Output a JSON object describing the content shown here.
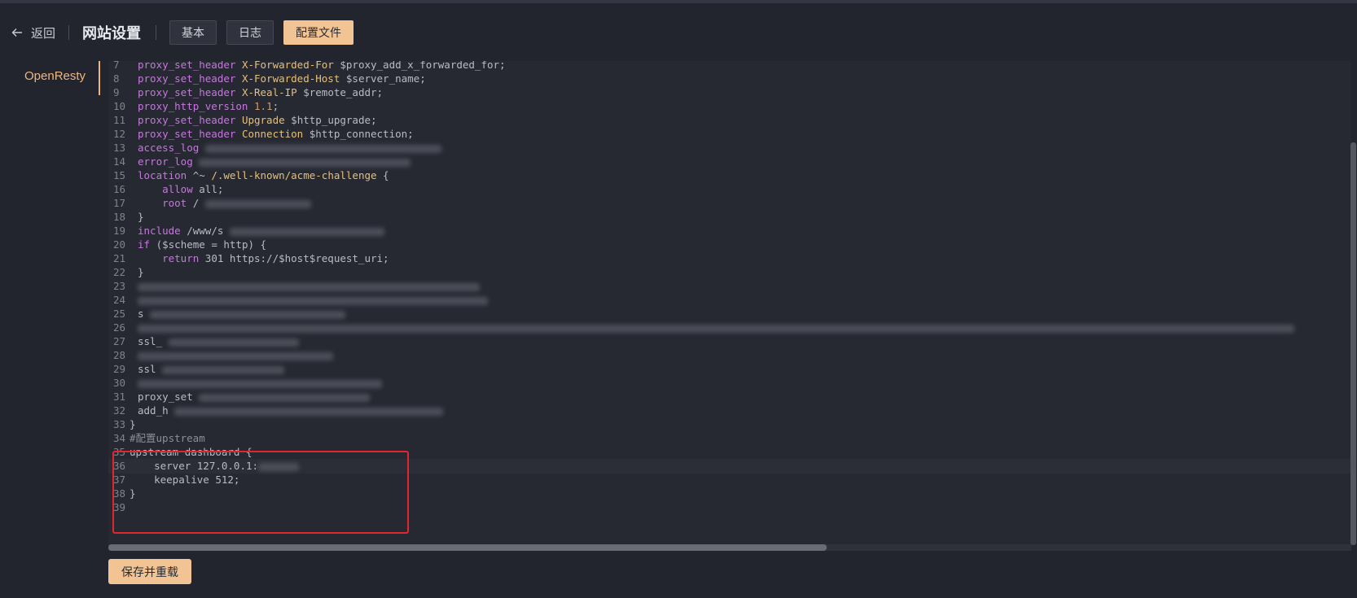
{
  "header": {
    "back_label": "返回",
    "title": "网站设置",
    "tabs": [
      {
        "label": "基本",
        "active": false
      },
      {
        "label": "日志",
        "active": false
      },
      {
        "label": "配置文件",
        "active": true
      }
    ]
  },
  "sidebar": {
    "items": [
      {
        "label": "OpenResty",
        "active": true
      }
    ]
  },
  "editor": {
    "lines": [
      {
        "n": "7",
        "code": "    proxy_set_header X-Forwarded-For $proxy_add_x_forwarded_for;"
      },
      {
        "n": "8",
        "code": "    proxy_set_header X-Forwarded-Host $server_name;"
      },
      {
        "n": "9",
        "code": "    proxy_set_header X-Real-IP $remote_addr;"
      },
      {
        "n": "10",
        "code": "    proxy_http_version 1.1;"
      },
      {
        "n": "11",
        "code": "    proxy_set_header Upgrade $http_upgrade;"
      },
      {
        "n": "12",
        "code": "    proxy_set_header Connection $http_connection;"
      },
      {
        "n": "13",
        "code": "    access_log"
      },
      {
        "n": "14",
        "code": "    error_log"
      },
      {
        "n": "15",
        "code": "    location ^~ /.well-known/acme-challenge {"
      },
      {
        "n": "16",
        "code": "        allow all;"
      },
      {
        "n": "17",
        "code": "        root /"
      },
      {
        "n": "18",
        "code": "    }"
      },
      {
        "n": "19",
        "code": "    include /www/s"
      },
      {
        "n": "20",
        "code": "    if ($scheme = http) {"
      },
      {
        "n": "21",
        "code": "        return 301 https://$host$request_uri;"
      },
      {
        "n": "22",
        "code": "    }"
      },
      {
        "n": "23",
        "code": ""
      },
      {
        "n": "24",
        "code": ""
      },
      {
        "n": "25",
        "code": "    s"
      },
      {
        "n": "26",
        "code": ""
      },
      {
        "n": "27",
        "code": "    ssl_"
      },
      {
        "n": "28",
        "code": ""
      },
      {
        "n": "29",
        "code": "    ssl"
      },
      {
        "n": "30",
        "code": ""
      },
      {
        "n": "31",
        "code": "    proxy_set"
      },
      {
        "n": "32",
        "code": "    add_h"
      },
      {
        "n": "33",
        "code": "}"
      },
      {
        "n": "34",
        "code": "#配置upstream"
      },
      {
        "n": "35",
        "code": "upstream dashboard {"
      },
      {
        "n": "36",
        "code": "    server 127.0.0.1:"
      },
      {
        "n": "37",
        "code": "    keepalive 512;"
      },
      {
        "n": "38",
        "code": "}"
      },
      {
        "n": "39",
        "code": ""
      }
    ]
  },
  "footer": {
    "save_label": "保存并重载"
  },
  "colors": {
    "accent": "#f2c494",
    "highlight_box": "#e0262f",
    "background": "#23252e"
  }
}
